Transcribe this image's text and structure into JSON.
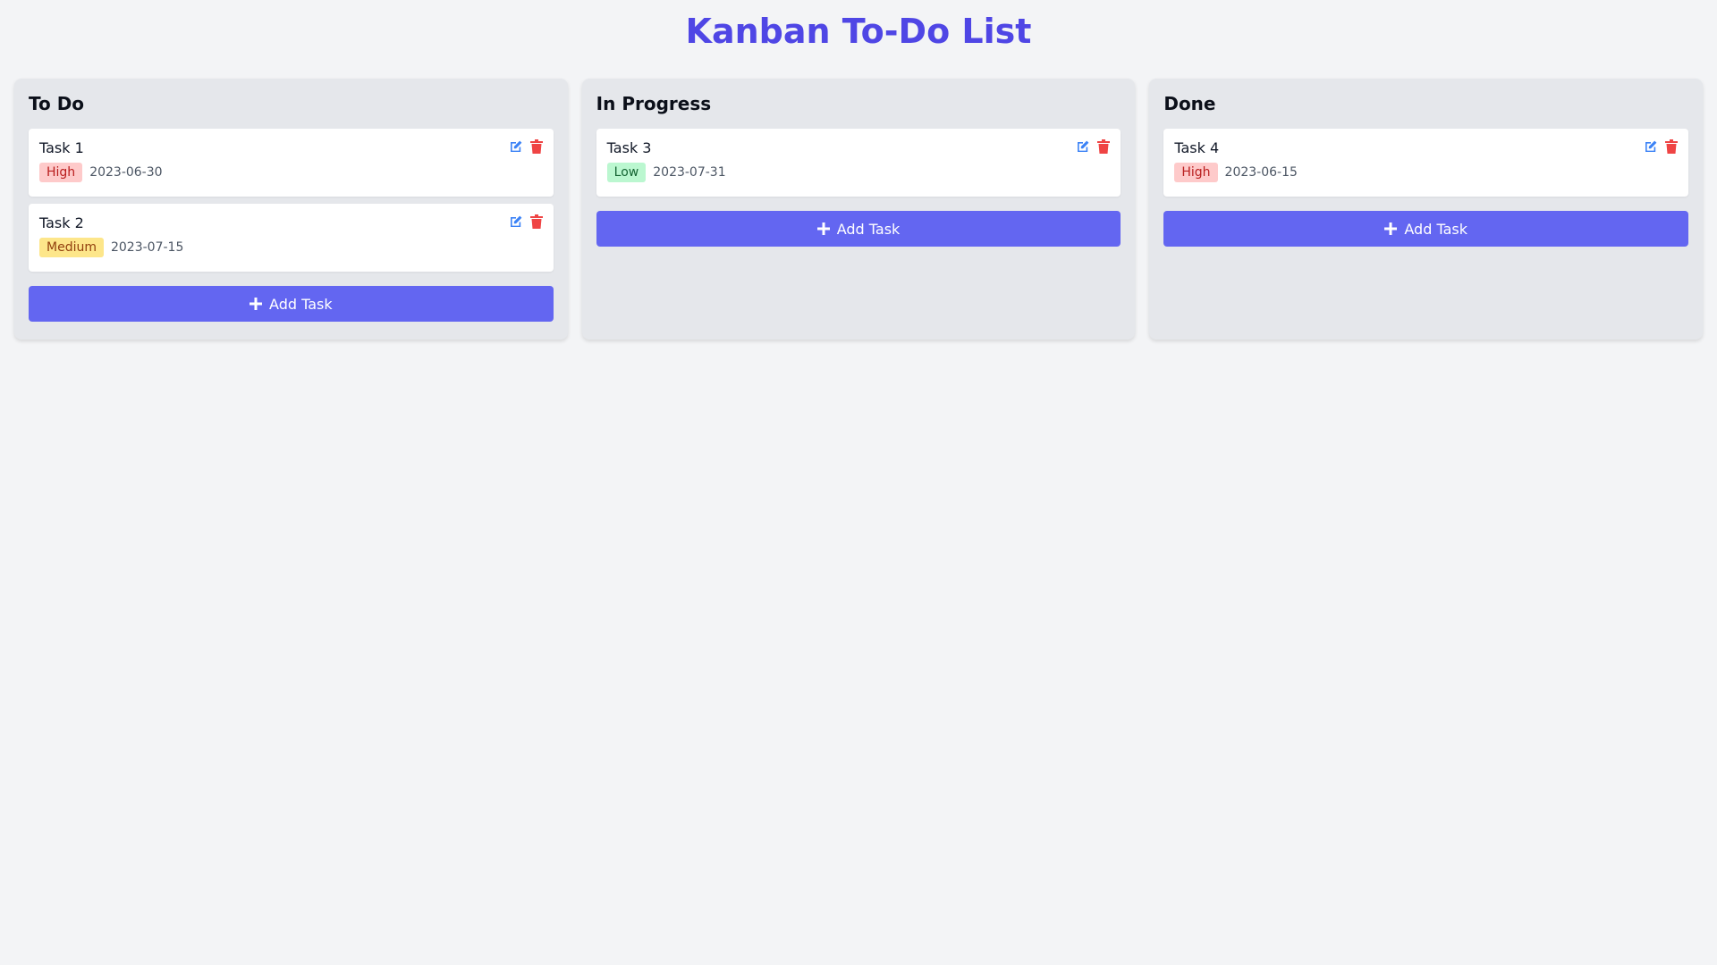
{
  "page": {
    "title": "Kanban To-Do List"
  },
  "colors": {
    "accent": "#6366f1",
    "title": "#4f46e5",
    "edit": "#3b82f6",
    "delete": "#ef4444"
  },
  "columns": [
    {
      "title": "To Do",
      "add_label": "Add Task",
      "tasks": [
        {
          "title": "Task 1",
          "priority": "High",
          "due": "2023-06-30"
        },
        {
          "title": "Task 2",
          "priority": "Medium",
          "due": "2023-07-15"
        }
      ]
    },
    {
      "title": "In Progress",
      "add_label": "Add Task",
      "tasks": [
        {
          "title": "Task 3",
          "priority": "Low",
          "due": "2023-07-31"
        }
      ]
    },
    {
      "title": "Done",
      "add_label": "Add Task",
      "tasks": [
        {
          "title": "Task 4",
          "priority": "High",
          "due": "2023-06-15"
        }
      ]
    }
  ],
  "icons": {
    "edit": "edit-icon",
    "delete": "trash-icon",
    "add": "plus-icon"
  }
}
